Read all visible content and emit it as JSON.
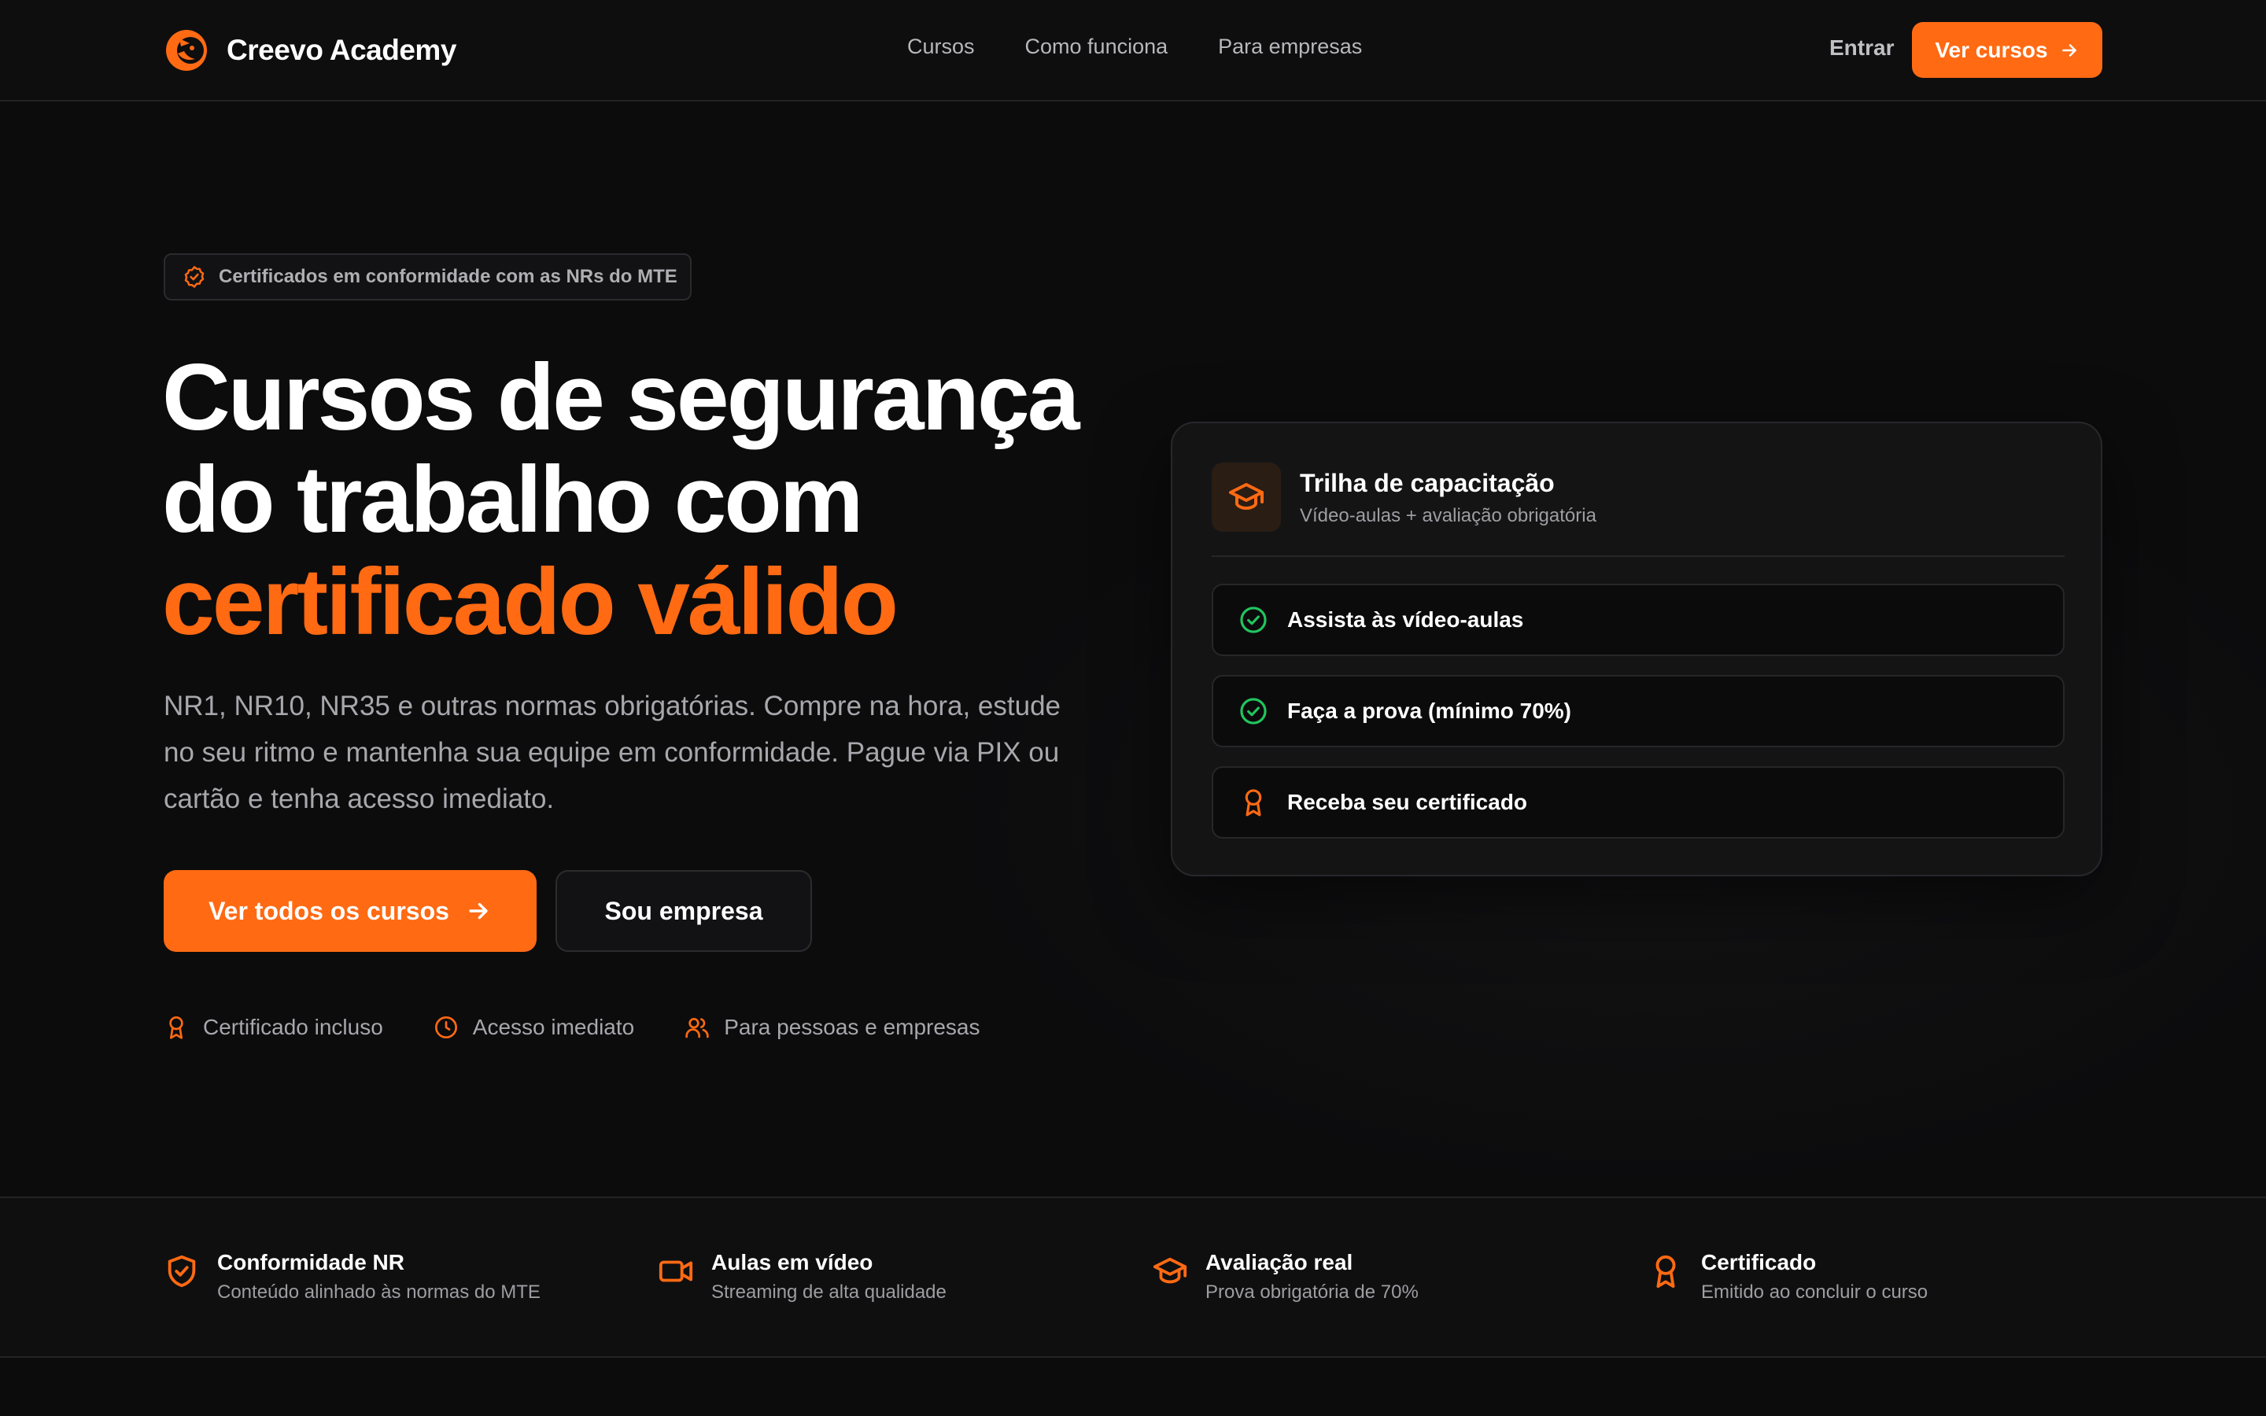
{
  "header": {
    "brand_name": "Creevo Academy",
    "nav": [
      "Cursos",
      "Como funciona",
      "Para empresas"
    ],
    "login_label": "Entrar",
    "cta_label": "Ver cursos"
  },
  "hero": {
    "badge": "Certificados em conformidade com as NRs do MTE",
    "headline_line1": "Cursos de segurança",
    "headline_line2": "do trabalho com",
    "headline_accent": "certificado válido",
    "lead": "NR1, NR10, NR35 e outras normas obrigatórias. Compre na hora, estude no seu ritmo e mantenha sua equipe em conformidade. Pague via PIX ou cartão e tenha acesso imediato.",
    "primary_cta": "Ver todos os cursos",
    "secondary_cta": "Sou empresa",
    "perks": [
      "Certificado incluso",
      "Acesso imediato",
      "Para pessoas e empresas"
    ]
  },
  "card": {
    "title": "Trilha de capacitação",
    "subtitle": "Vídeo-aulas + avaliação obrigatória",
    "steps": [
      "Assista às vídeo-aulas",
      "Faça a prova (mínimo 70%)",
      "Receba seu certificado"
    ]
  },
  "features": [
    {
      "title": "Conformidade NR",
      "desc": "Conteúdo alinhado às normas do MTE",
      "icon": "shield-check-icon"
    },
    {
      "title": "Aulas em vídeo",
      "desc": "Streaming de alta qualidade",
      "icon": "video-icon"
    },
    {
      "title": "Avaliação real",
      "desc": "Prova obrigatória de 70%",
      "icon": "graduation-cap-icon"
    },
    {
      "title": "Certificado",
      "desc": "Emitido ao concluir o curso",
      "icon": "award-icon"
    }
  ],
  "colors": {
    "accent": "#ff6a13",
    "background": "#0c0c0d",
    "success": "#22c55e"
  }
}
